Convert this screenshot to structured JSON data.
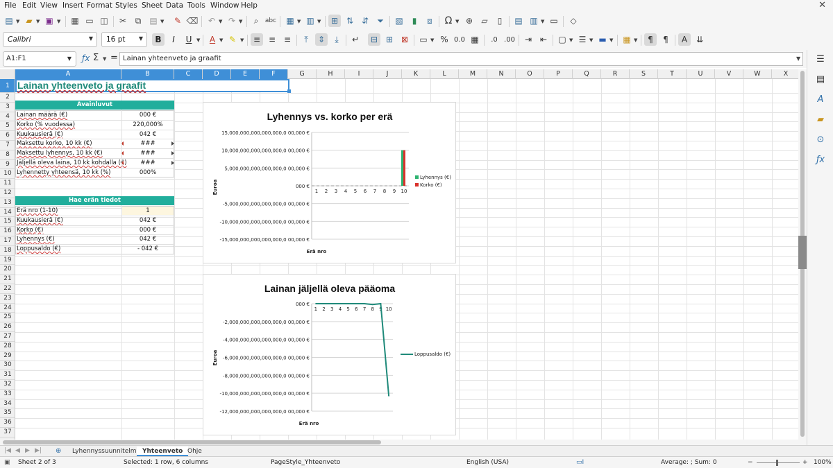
{
  "menu": [
    "File",
    "Edit",
    "View",
    "Insert",
    "Format",
    "Styles",
    "Sheet",
    "Data",
    "Tools",
    "Window",
    "Help"
  ],
  "toolbar2": {
    "font_name": "Calibri",
    "font_size": "16 pt"
  },
  "formula_bar": {
    "name_box": "A1:F1",
    "content": "Lainan yhteenveto ja graafit"
  },
  "columns": [
    "A",
    "B",
    "C",
    "D",
    "E",
    "F",
    "G",
    "H",
    "I",
    "J",
    "K",
    "L",
    "M",
    "N",
    "O",
    "P",
    "Q",
    "R",
    "S",
    "T",
    "U",
    "V",
    "W",
    "X"
  ],
  "rows": [
    "1",
    "2",
    "3",
    "4",
    "5",
    "6",
    "7",
    "8",
    "9",
    "10",
    "11",
    "12",
    "13",
    "14",
    "15",
    "16",
    "17",
    "18",
    "19",
    "20",
    "21",
    "22",
    "23",
    "24",
    "25",
    "26",
    "27",
    "28",
    "29",
    "30",
    "31",
    "32",
    "33",
    "34",
    "35",
    "36",
    "37"
  ],
  "sheet": {
    "title": "Lainan yhteenveto ja graafit",
    "key_figures": {
      "header": "Avainluvut",
      "rows": [
        {
          "label": "Lainan määrä (€)",
          "value": "000 €"
        },
        {
          "label": "Korko (% vuodessa)",
          "value": "220,000%"
        },
        {
          "label": "Kuukausierä (€)",
          "value": "042 €"
        },
        {
          "label": "Maksettu korko, 10 kk (€)",
          "value": "###"
        },
        {
          "label": "Maksettu lyhennys, 10 kk (€)",
          "value": "###"
        },
        {
          "label": "Jäljellä oleva laina, 10 kk kohdalla (€)",
          "value": "###"
        },
        {
          "label": "Lyhennetty yhteensä, 10 kk (%)",
          "value": "000%"
        }
      ]
    },
    "lookup": {
      "header": "Hae erän tiedot",
      "rows": [
        {
          "label": "Erä nro (1-10)",
          "value": "1"
        },
        {
          "label": "Kuukausierä (€)",
          "value": "042 €"
        },
        {
          "label": "Korko (€)",
          "value": "000 €"
        },
        {
          "label": "Lyhennys (€)",
          "value": "042 €"
        },
        {
          "label": "Loppusaldo (€)",
          "value": "- 042 €"
        }
      ]
    }
  },
  "chart_data": [
    {
      "type": "bar",
      "title": "Lyhennys vs. korko per erä",
      "xlabel": "Erä nro",
      "ylabel": "Euroa",
      "categories": [
        "1",
        "2",
        "3",
        "4",
        "5",
        "6",
        "7",
        "8",
        "9",
        "10"
      ],
      "y_ticks": [
        "15,000,000,000,000,000,0 00,000 €",
        "10,000,000,000,000,000,0 00,000 €",
        "5,000,000,000,000,000,0 00,000 €",
        "000 €",
        "-5,000,000,000,000,000,0 00,000 €",
        "-10,000,000,000,000,000,0 00,000 €",
        "-15,000,000,000,000,000,0 00,000 €"
      ],
      "ylim": [
        -15,
        15
      ],
      "y_unit_note": "values in units of 1e21 €",
      "series": [
        {
          "name": "Lyhennys (€)",
          "color": "#2db370",
          "values": [
            0,
            0,
            0,
            0,
            0,
            0,
            0,
            0,
            0,
            10.0
          ]
        },
        {
          "name": "Korko (€)",
          "color": "#d9322c",
          "values": [
            0,
            0,
            0,
            0,
            0,
            0,
            0,
            0,
            0,
            10.0
          ]
        }
      ],
      "legend": "right",
      "grid": true
    },
    {
      "type": "line",
      "title": "Lainan jäljellä oleva pääoma",
      "xlabel": "Erä nro",
      "ylabel": "Euroa",
      "categories": [
        "1",
        "2",
        "3",
        "4",
        "5",
        "6",
        "7",
        "8",
        "9",
        "10"
      ],
      "y_ticks": [
        "000 €",
        "-2,000,000,000,000,000,0 00,000 €",
        "-4,000,000,000,000,000,0 00,000 €",
        "-6,000,000,000,000,000,0 00,000 €",
        "-8,000,000,000,000,000,0 00,000 €",
        "-10,000,000,000,000,000,0 00,000 €",
        "-12,000,000,000,000,000,0 00,000 €"
      ],
      "ylim": [
        -12,
        0
      ],
      "y_unit_note": "values in units of 1e21 €",
      "series": [
        {
          "name": "Loppusaldo (€)",
          "color": "#1f8a7a",
          "values": [
            0,
            0,
            0,
            0,
            0,
            0,
            0,
            -0.1,
            0,
            -10.3
          ]
        }
      ],
      "legend": "right",
      "grid": true
    }
  ],
  "tabs": {
    "items": [
      "Lyhennyssuunnitelma",
      "Yhteenveto",
      "Ohje"
    ],
    "active": "Yhteenveto"
  },
  "status": {
    "sheet": "Sheet 2 of 3",
    "selection": "Selected: 1 row, 6 columns",
    "page_style": "PageStyle_Yhteenveto",
    "language": "English (USA)",
    "summary": "Average: ; Sum: 0",
    "zoom": "100%"
  }
}
